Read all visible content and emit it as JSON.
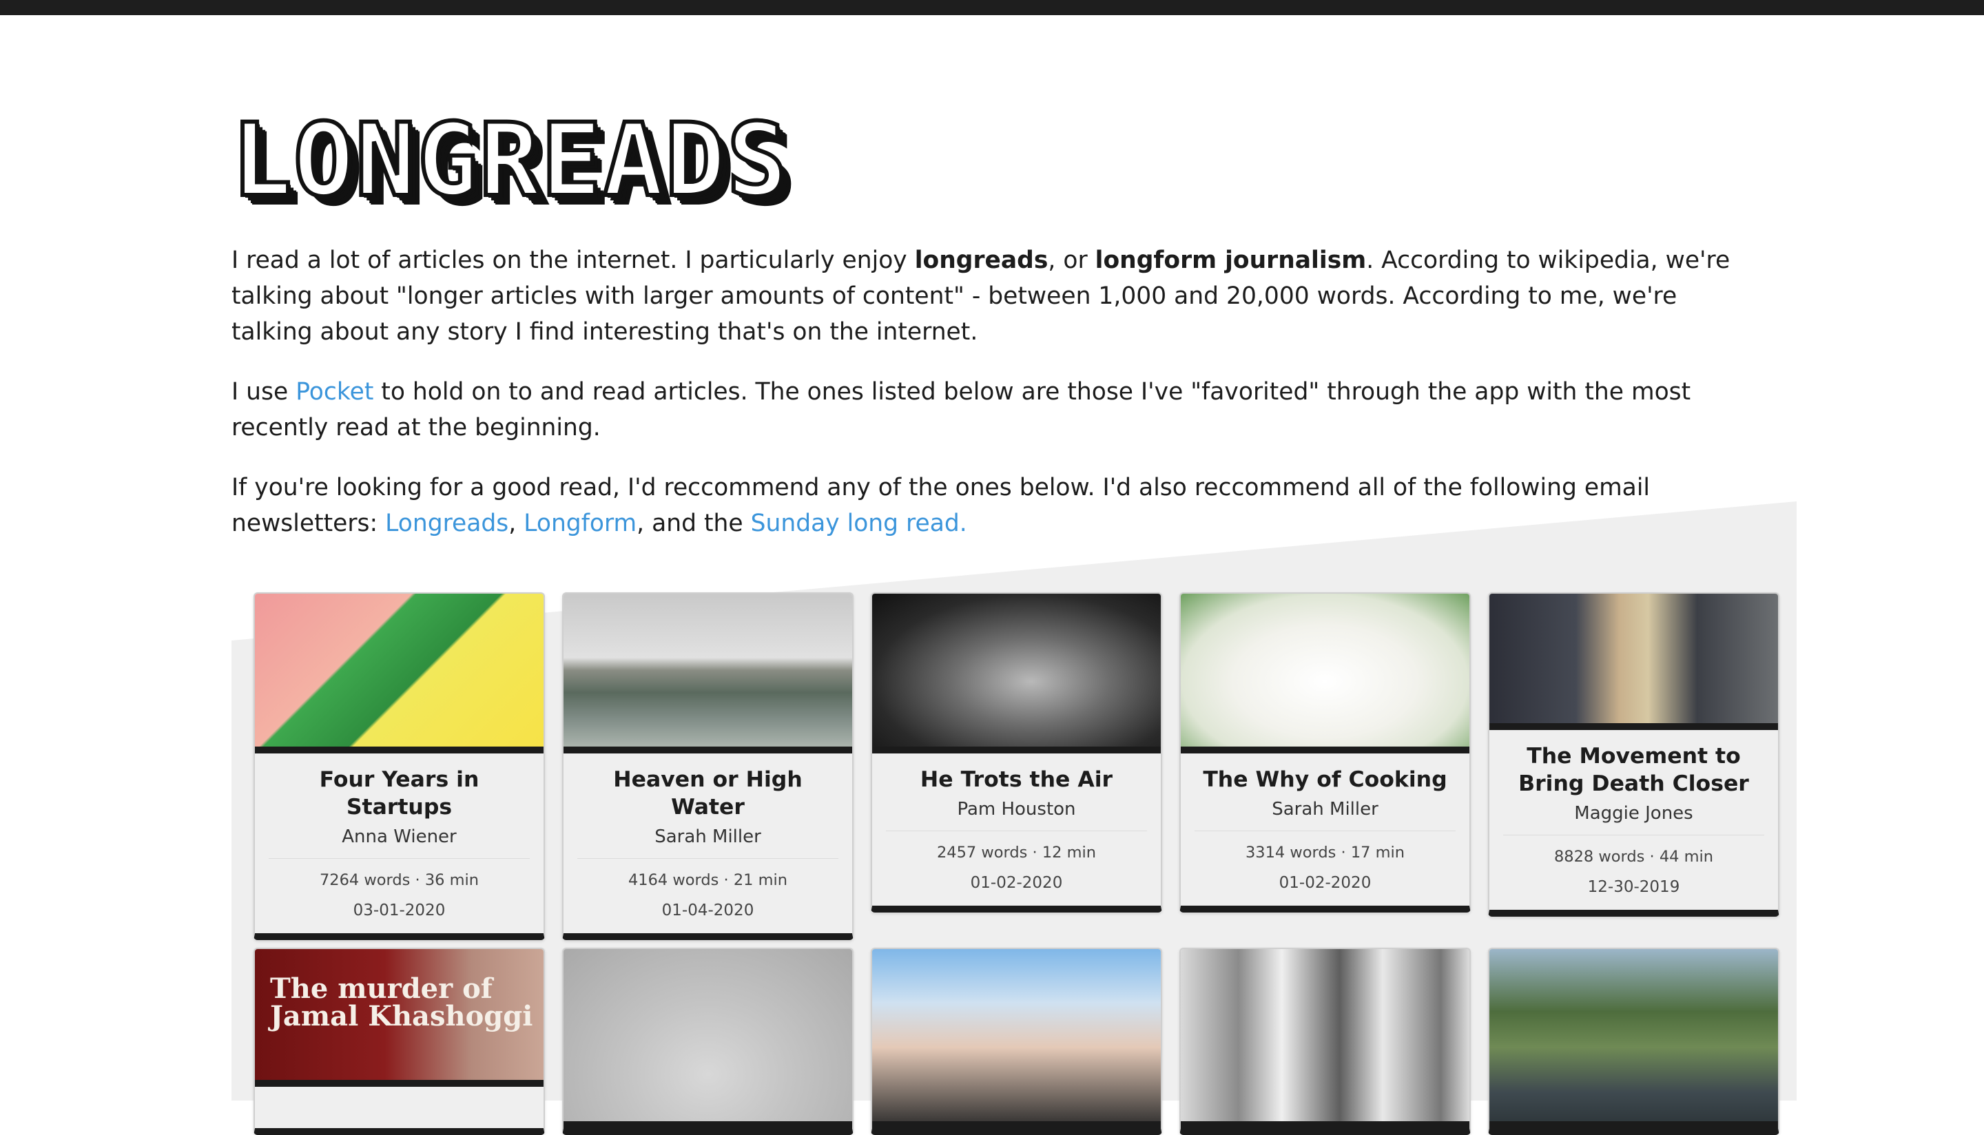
{
  "site": {
    "title": "Longreads"
  },
  "intro": {
    "p1": {
      "t1": "I read a lot of articles on the internet. I particularly enjoy ",
      "b1": "longreads",
      "t2": ", or ",
      "b2": "longform journalism",
      "t3": ". According to wikipedia, we're talking about \"longer articles with larger amounts of content\" - between 1,000 and 20,000 words. According to me, we're talking about any story I find interesting that's on the internet."
    },
    "p2": {
      "t1": "I use ",
      "link": "Pocket",
      "t2": " to hold on to and read articles. The ones listed below are those I've \"favorited\" through the app with the most recently read at the beginning."
    },
    "p3": {
      "t1": "If you're looking for a good read, I'd reccommend any of the ones below. I'd also reccommend all of the following email newsletters: ",
      "link1": "Longreads",
      "sep": ", ",
      "link2": "Longform",
      "t2": ", and the ",
      "link3": "Sunday long read."
    }
  },
  "colors": {
    "link": "#3b95db",
    "card_bg": "#efefef",
    "card_border": "#1b1b1b",
    "slant_bg": "#efefef"
  },
  "articles": [
    {
      "title": "Four Years in Startups",
      "author": "Anna Wiener",
      "meta": "7264 words · 36 min",
      "date": "03-01-2020",
      "image": "isometric-office-illustration"
    },
    {
      "title": "Heaven or High Water",
      "author": "Sarah Miller",
      "meta": "4164 words · 21 min",
      "date": "01-04-2020",
      "image": "flooded-causeway-photo"
    },
    {
      "title": "He Trots the Air",
      "author": "Pam Houston",
      "meta": "2457 words · 12 min",
      "date": "01-02-2020",
      "image": "bull-photo"
    },
    {
      "title": "The Why of Cooking",
      "author": "Sarah Miller",
      "meta": "3314 words · 17 min",
      "date": "01-02-2020",
      "image": "cake-face-photo"
    },
    {
      "title": "The Movement to Bring Death Closer",
      "author": "Maggie Jones",
      "meta": "8828 words · 44 min",
      "date": "12-30-2019",
      "image": "framed-portrait-photo"
    }
  ],
  "second_row": [
    {
      "image": "khashoggi-cover",
      "overlay": "The murder of Jamal Khashoggi"
    },
    {
      "image": "child-portrait-photo"
    },
    {
      "image": "group-selfie-photo"
    },
    {
      "image": "three-men-portrait"
    },
    {
      "image": "outdoor-crowd-photo"
    }
  ]
}
